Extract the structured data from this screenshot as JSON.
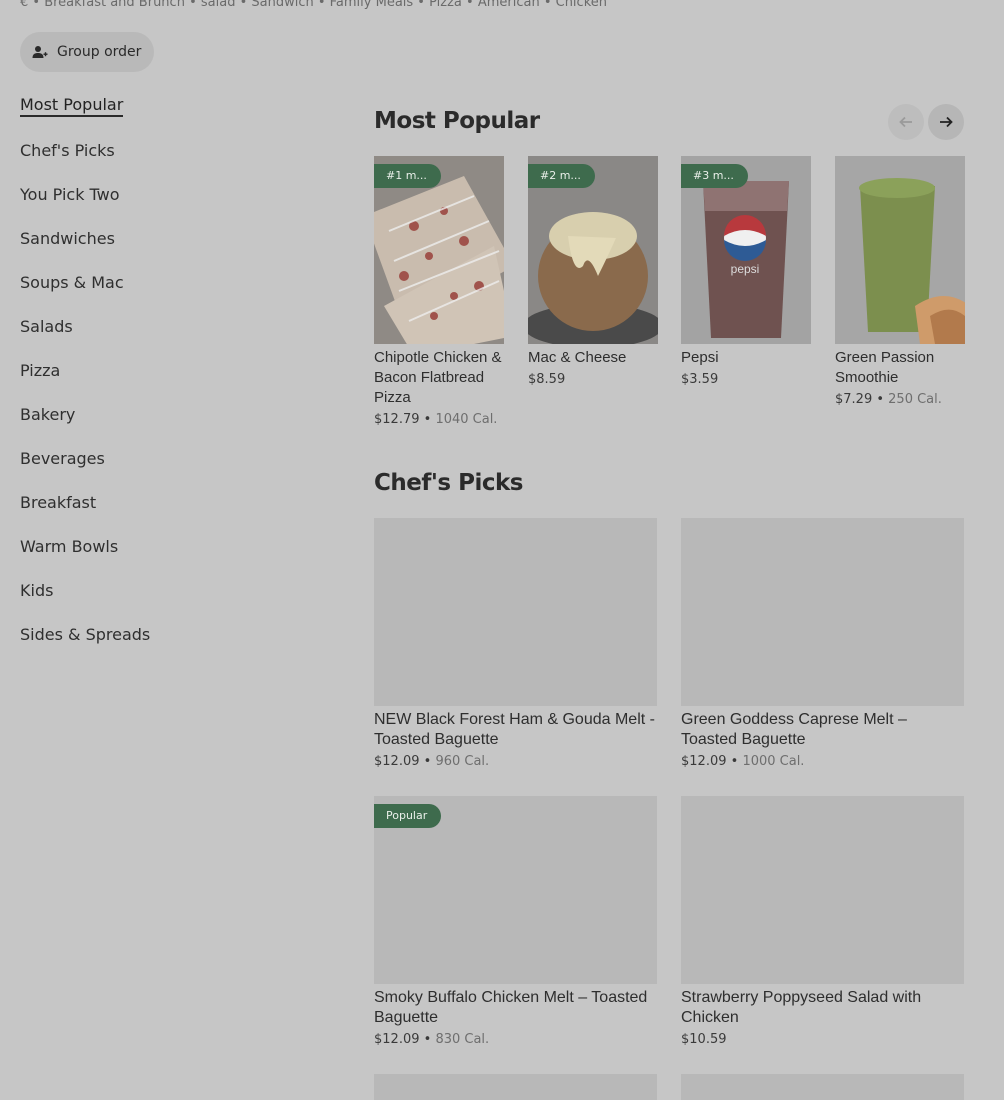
{
  "header": {
    "tags": "€ • Breakfast and Brunch • salad • Sandwich • Family Meals • Pizza • American • Chicken",
    "group_order_label": "Group order"
  },
  "sidebar": {
    "items": [
      {
        "label": "Most Popular"
      },
      {
        "label": "Chef's Picks"
      },
      {
        "label": "You Pick Two"
      },
      {
        "label": "Sandwiches"
      },
      {
        "label": "Soups & Mac"
      },
      {
        "label": "Salads"
      },
      {
        "label": "Pizza"
      },
      {
        "label": "Bakery"
      },
      {
        "label": "Beverages"
      },
      {
        "label": "Breakfast"
      },
      {
        "label": "Warm Bowls"
      },
      {
        "label": "Kids"
      },
      {
        "label": "Sides & Spreads"
      }
    ]
  },
  "most_popular": {
    "title": "Most Popular",
    "items": [
      {
        "badge": "#1 m...",
        "name": "Chipotle Chicken & Bacon Flatbread Pizza",
        "price": "$12.79",
        "calories": "1040 Cal."
      },
      {
        "badge": "#2 m...",
        "name": "Mac & Cheese",
        "price": "$8.59"
      },
      {
        "badge": "#3 m...",
        "name": "Pepsi",
        "price": "$3.59",
        "logo_text": "pepsi"
      },
      {
        "name": "Green Passion Smoothie",
        "price": "$7.29",
        "calories": "250 Cal."
      }
    ]
  },
  "chefs_picks": {
    "title": "Chef's Picks",
    "items": [
      {
        "name": "NEW Black Forest Ham & Gouda Melt - Toasted Baguette",
        "price": "$12.09",
        "calories": "960 Cal."
      },
      {
        "name": "Green Goddess Caprese Melt – Toasted Baguette",
        "price": "$12.09",
        "calories": "1000 Cal."
      },
      {
        "badge": "Popular",
        "name": "Smoky Buffalo Chicken Melt – Toasted Baguette",
        "price": "$12.09",
        "calories": "830 Cal."
      },
      {
        "name": "Strawberry Poppyseed Salad with Chicken",
        "price": "$10.59"
      }
    ]
  },
  "colors": {
    "background": "#c6c6c6",
    "badge": "#3e6b4d"
  },
  "icons": {
    "group_order": "person-plus-icon",
    "prev": "arrow-left-icon",
    "next": "arrow-right-icon"
  },
  "separator": " • "
}
